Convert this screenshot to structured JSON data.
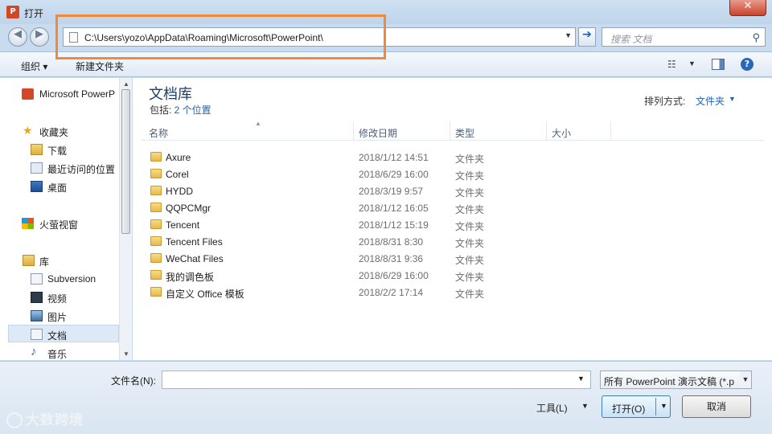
{
  "window": {
    "title": "打开",
    "app_icon": "P",
    "close_label": "✕"
  },
  "address": {
    "path": "C:\\Users\\yozo\\AppData\\Roaming\\Microsoft\\PowerPoint\\"
  },
  "search": {
    "placeholder": "搜索 文档"
  },
  "toolbar": {
    "organize": "组织 ▾",
    "new_folder": "新建文件夹",
    "view": "☷",
    "help": "?"
  },
  "sidebar": {
    "items": [
      {
        "label": "Microsoft PowerP",
        "icon": "powerpoint-icon"
      },
      {
        "label": "收藏夹",
        "icon": "star-icon"
      },
      {
        "label": "下载",
        "icon": "download-folder-icon"
      },
      {
        "label": "最近访问的位置",
        "icon": "recent-places-icon"
      },
      {
        "label": "桌面",
        "icon": "desktop-icon"
      },
      {
        "label": "火萤视窗",
        "icon": "windows-icon"
      },
      {
        "label": "库",
        "icon": "library-icon"
      },
      {
        "label": "Subversion",
        "icon": "document-icon"
      },
      {
        "label": "视频",
        "icon": "video-icon"
      },
      {
        "label": "图片",
        "icon": "picture-icon"
      },
      {
        "label": "文档",
        "icon": "document-icon",
        "selected": true
      },
      {
        "label": "音乐",
        "icon": "music-icon"
      }
    ]
  },
  "library": {
    "title": "文档库",
    "sub_prefix": "包括: ",
    "sub_link": "2 个位置",
    "arrange_label": "排列方式:",
    "arrange_value": "文件夹"
  },
  "columns": {
    "name": "名称",
    "modified": "修改日期",
    "type": "类型",
    "size": "大小"
  },
  "files": [
    {
      "name": "Axure",
      "modified": "2018/1/12 14:51",
      "type": "文件夹"
    },
    {
      "name": "Corel",
      "modified": "2018/6/29 16:00",
      "type": "文件夹"
    },
    {
      "name": "HYDD",
      "modified": "2018/3/19 9:57",
      "type": "文件夹"
    },
    {
      "name": "QQPCMgr",
      "modified": "2018/1/12 16:05",
      "type": "文件夹"
    },
    {
      "name": "Tencent",
      "modified": "2018/1/12 15:19",
      "type": "文件夹"
    },
    {
      "name": "Tencent Files",
      "modified": "2018/8/31 8:30",
      "type": "文件夹"
    },
    {
      "name": "WeChat Files",
      "modified": "2018/8/31 9:36",
      "type": "文件夹"
    },
    {
      "name": "我的调色板",
      "modified": "2018/6/29 16:00",
      "type": "文件夹"
    },
    {
      "name": "自定义 Office 模板",
      "modified": "2018/2/2 17:14",
      "type": "文件夹"
    }
  ],
  "bottom": {
    "filename_label": "文件名(N):",
    "filename_value": "",
    "filetype": "所有 PowerPoint 演示文稿 (*.p",
    "tools": "工具(L)",
    "open": "打开(O)",
    "cancel": "取消"
  },
  "watermark": {
    "text": "大数跨境"
  },
  "colors": {
    "highlight": "#ef8a3a",
    "link": "#2063b5",
    "title_bar": "#cfe0f2"
  }
}
